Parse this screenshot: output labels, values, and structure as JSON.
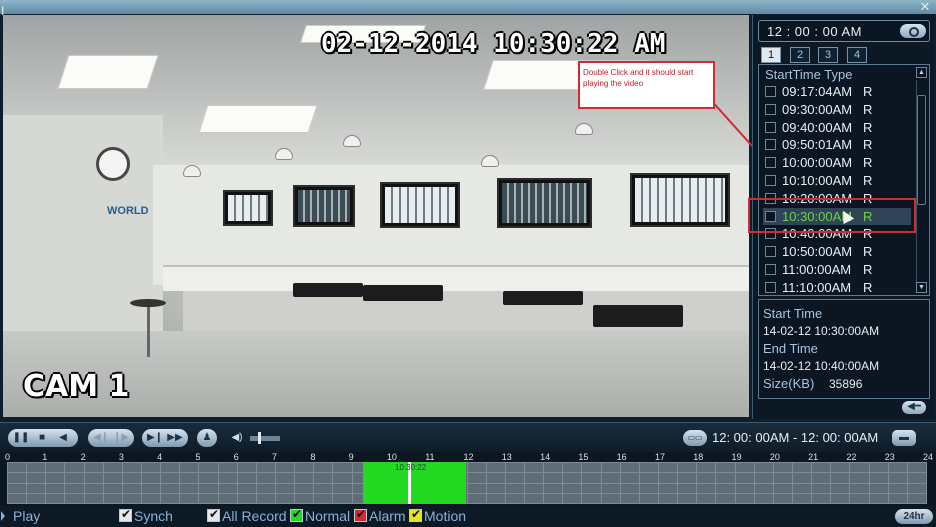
{
  "window": {
    "close_glyph": "✕"
  },
  "video": {
    "osd_datetime": "02-12-2014 10:30:22 AM",
    "osd_camera": "CAM 1",
    "brand_sign": "WORLD",
    "annotation": "Double Click and it should start playing the video"
  },
  "panel": {
    "time_value": "12 : 00 : 00 AM",
    "tabs": [
      "1",
      "2",
      "3",
      "4"
    ],
    "list_header": "StartTime Type",
    "rows": [
      {
        "time": "09:17:04AM",
        "type": "R"
      },
      {
        "time": "09:30:00AM",
        "type": "R"
      },
      {
        "time": "09:40:00AM",
        "type": "R"
      },
      {
        "time": "09:50:01AM",
        "type": "R"
      },
      {
        "time": "10:00:00AM",
        "type": "R"
      },
      {
        "time": "10:10:00AM",
        "type": "R"
      },
      {
        "time": "10:20:00AM",
        "type": "R"
      },
      {
        "time": "10:30:00AM",
        "type": "R",
        "selected": true
      },
      {
        "time": "10:40:00AM",
        "type": "R"
      },
      {
        "time": "10:50:00AM",
        "type": "R"
      },
      {
        "time": "11:00:00AM",
        "type": "R"
      },
      {
        "time": "11:10:00AM",
        "type": "R"
      }
    ],
    "info": {
      "start_label": "Start Time",
      "start_value": "14-02-12  10:30:00AM",
      "end_label": "End Time",
      "end_value": "14-02-12  10:40:00AM",
      "size_label": "Size(KB)",
      "size_value": "35896"
    }
  },
  "controls": {
    "range_text": "12: 00: 00AM - 12: 00: 00AM"
  },
  "timeline": {
    "ticks": [
      "0",
      "1",
      "2",
      "3",
      "4",
      "5",
      "6",
      "7",
      "8",
      "9",
      "10",
      "11",
      "12",
      "13",
      "14",
      "15",
      "16",
      "17",
      "18",
      "19",
      "20",
      "21",
      "22",
      "23",
      "24"
    ],
    "record_start_hour": 9.3,
    "record_end_hour": 12.0,
    "playhead_hour": 10.5,
    "playhead_label": "10:30:22",
    "colors": {
      "record": "#23d922",
      "normal": "#23d922",
      "alarm": "#d62a2a",
      "motion": "#e3e32a"
    }
  },
  "legend": {
    "play": "Play",
    "synch": "Synch",
    "all_record": "All Record",
    "normal": "Normal",
    "alarm": "Alarm",
    "motion": "Motion",
    "h24": "24hr"
  }
}
